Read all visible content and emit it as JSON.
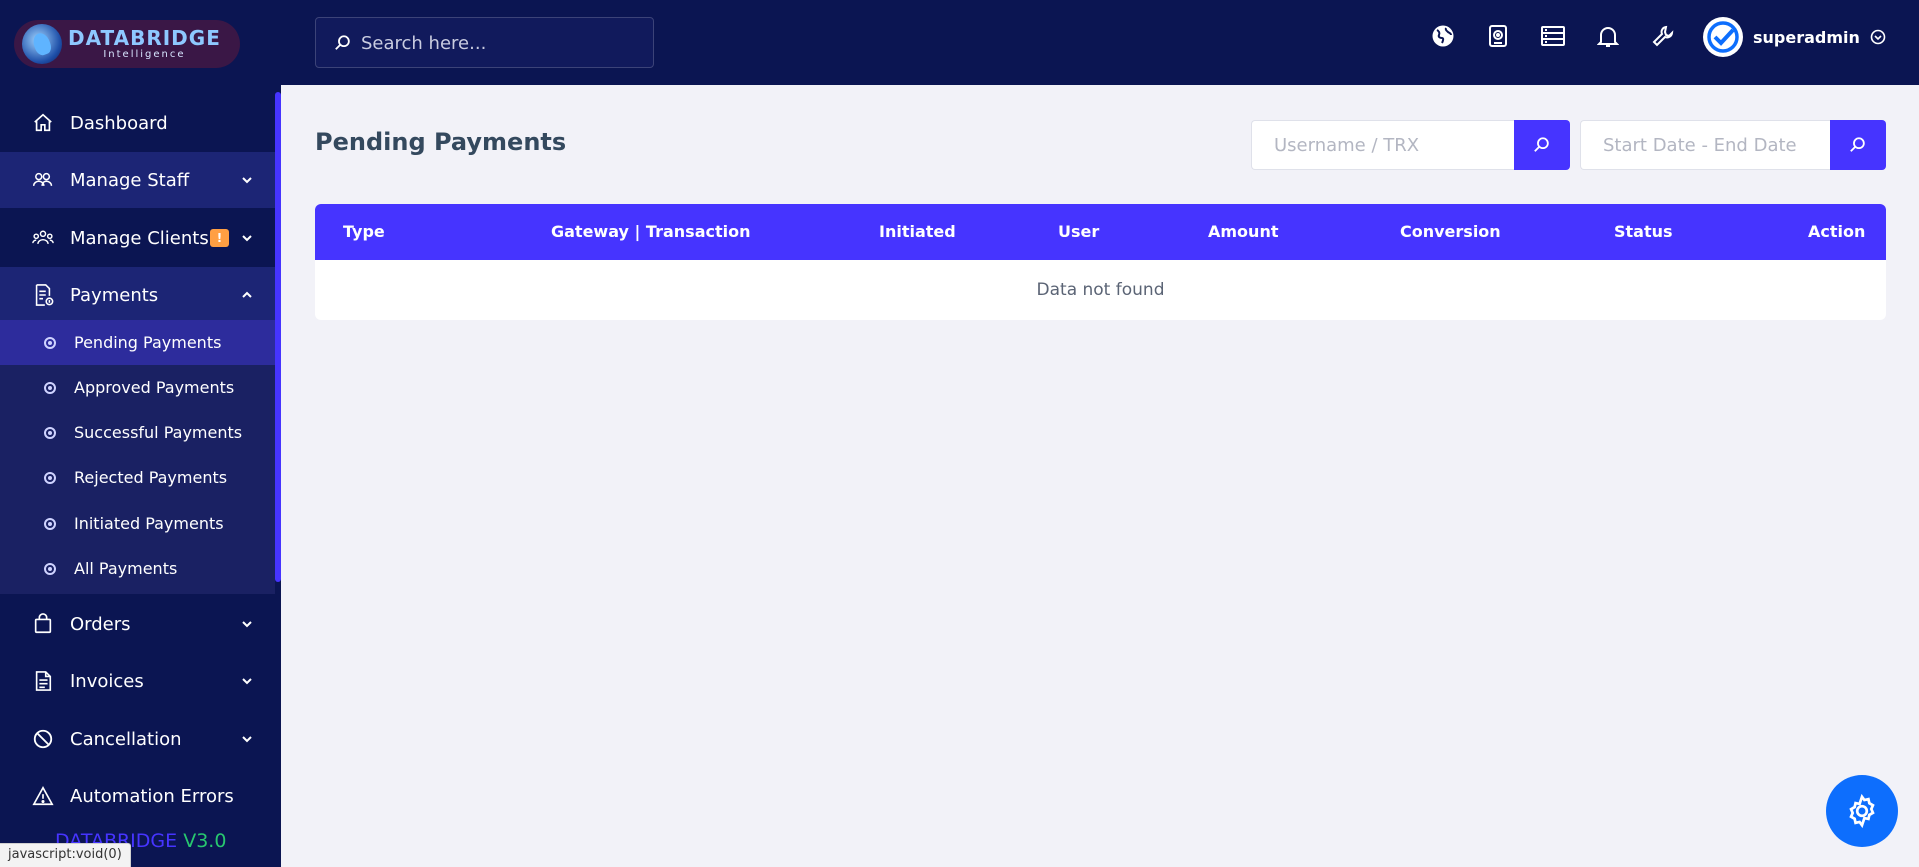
{
  "brand": {
    "name": "DATABRIDGE",
    "tagline": "Intelligence"
  },
  "search": {
    "placeholder": "Search here..."
  },
  "user": {
    "name": "superadmin"
  },
  "sidebar": {
    "items": [
      {
        "label": "Dashboard",
        "icon": "home-icon"
      },
      {
        "label": "Manage Staff",
        "icon": "users-icon"
      },
      {
        "label": "Manage Clients",
        "icon": "clients-icon",
        "badge": "!"
      },
      {
        "label": "Payments",
        "icon": "payments-icon"
      },
      {
        "label": "Orders",
        "icon": "bag-icon"
      },
      {
        "label": "Invoices",
        "icon": "invoice-icon"
      },
      {
        "label": "Cancellation",
        "icon": "ban-icon"
      },
      {
        "label": "Automation Errors",
        "icon": "warning-icon"
      }
    ],
    "payments_submenu": [
      {
        "label": "Pending Payments"
      },
      {
        "label": "Approved Payments"
      },
      {
        "label": "Successful Payments"
      },
      {
        "label": "Rejected Payments"
      },
      {
        "label": "Initiated Payments"
      },
      {
        "label": "All Payments"
      }
    ],
    "version": {
      "name": "DATABRIDGE",
      "number": "V3.0"
    }
  },
  "status_tip": "javascript:void(0)",
  "page": {
    "title": "Pending Payments",
    "filter_user_placeholder": "Username / TRX",
    "filter_date_placeholder": "Start Date - End Date"
  },
  "table": {
    "columns": [
      "Type",
      "Gateway | Transaction",
      "Initiated",
      "User",
      "Amount",
      "Conversion",
      "Status",
      "Action"
    ],
    "empty_text": "Data not found"
  },
  "colors": {
    "sidebar_bg": "#0b1552",
    "accent": "#4634ff",
    "page_bg": "#f2f2f8",
    "fab": "#0d6efd",
    "badge": "#ff9f43",
    "version_green": "#28c76f"
  }
}
